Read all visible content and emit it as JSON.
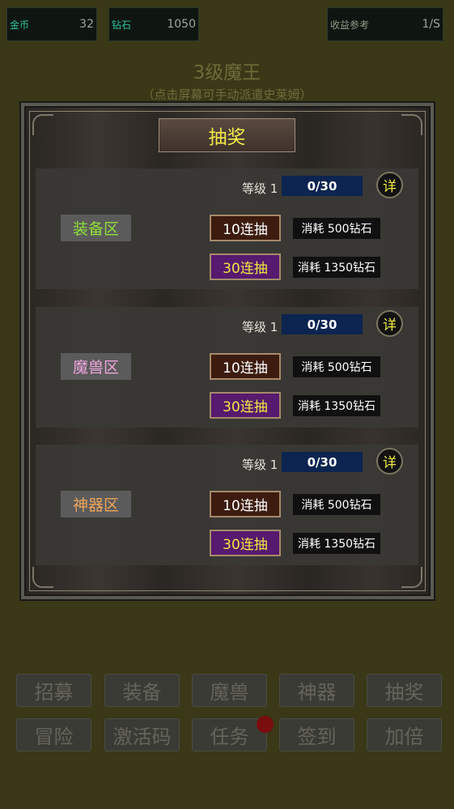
{
  "currency": {
    "gold_label": "金币",
    "gold_value": "32",
    "diamond_label": "钻石",
    "diamond_value": "1050",
    "income_label": "收益参考",
    "income_value": "1/S"
  },
  "stage": {
    "title": "3级魔王",
    "hint": "（点击屏幕可手动派遣史莱姆）"
  },
  "lottery": {
    "title": "抽奖",
    "sections": [
      {
        "name": "装备区",
        "name_color": "#8fe03a",
        "level_label": "等级 1",
        "progress": "0/30",
        "detail": "详",
        "draw10_label": "10连抽",
        "draw30_label": "30连抽",
        "cost10": "消耗 500钻石",
        "cost30": "消耗 1350钻石"
      },
      {
        "name": "魔兽区",
        "name_color": "#f0a6de",
        "level_label": "等级 1",
        "progress": "0/30",
        "detail": "详",
        "draw10_label": "10连抽",
        "draw30_label": "30连抽",
        "cost10": "消耗 500钻石",
        "cost30": "消耗 1350钻石"
      },
      {
        "name": "神器区",
        "name_color": "#f0a55a",
        "level_label": "等级 1",
        "progress": "0/30",
        "detail": "详",
        "draw10_label": "10连抽",
        "draw30_label": "30连抽",
        "cost10": "消耗 500钻石",
        "cost30": "消耗 1350钻石"
      }
    ]
  },
  "menu": {
    "row1": [
      "招募",
      "装备",
      "魔兽",
      "神器",
      "抽奖"
    ],
    "row2": [
      "冒险",
      "激活码",
      "任务",
      "签到",
      "加倍"
    ]
  }
}
